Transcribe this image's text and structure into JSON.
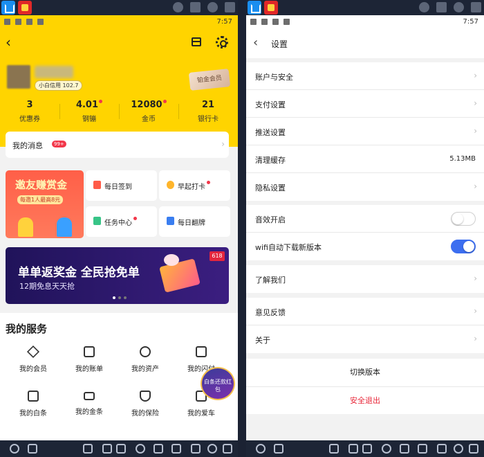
{
  "status_bar": {
    "time": "7:57"
  },
  "finance_home": {
    "credit_tag": "小白信用 102.7",
    "vip_label": "铂金会员",
    "stats": [
      {
        "value": "3",
        "label": "优惠券"
      },
      {
        "value": "4.01",
        "label": "钢镚"
      },
      {
        "value": "12080",
        "label": "金币"
      },
      {
        "value": "21",
        "label": "银行卡"
      }
    ],
    "messages": {
      "label": "我的消息",
      "badge": "99+"
    },
    "invite": {
      "title": "邀友赚赏金",
      "sub": "每邀1人最高8元"
    },
    "tiles": [
      {
        "label": "每日签到"
      },
      {
        "label": "早起打卡"
      },
      {
        "label": "任务中心"
      },
      {
        "label": "每日翻牌"
      }
    ],
    "banner": {
      "title": "单单返奖金 全民抢免单",
      "sub": "12期免息天天抢",
      "tag": "618"
    },
    "services": {
      "title": "我的服务",
      "items": [
        {
          "label": "我的会员"
        },
        {
          "label": "我的账单"
        },
        {
          "label": "我的资产"
        },
        {
          "label": "我的闪付"
        },
        {
          "label": "我的白条"
        },
        {
          "label": "我的金条"
        },
        {
          "label": "我的保险"
        },
        {
          "label": "我的爱车"
        }
      ]
    },
    "floating_promo": "白条还款红包",
    "colors": {
      "brand_yellow": "#ffd400",
      "badge_red": "#f2374a"
    }
  },
  "settings": {
    "title": "设置",
    "group1": [
      {
        "label": "账户与安全"
      },
      {
        "label": "支付设置"
      },
      {
        "label": "推送设置"
      },
      {
        "label": "清理缓存",
        "value": "5.13MB"
      },
      {
        "label": "隐私设置"
      }
    ],
    "group2": [
      {
        "label": "音效开启",
        "toggle": false
      },
      {
        "label": "wifi自动下载新版本",
        "toggle": true
      }
    ],
    "about_us": "了解我们",
    "group3": [
      {
        "label": "意见反馈"
      },
      {
        "label": "关于"
      }
    ],
    "switch_version": "切换版本",
    "logout": "安全退出",
    "colors": {
      "toggle_on": "#3c6ef0",
      "logout_red": "#e8283a"
    }
  }
}
